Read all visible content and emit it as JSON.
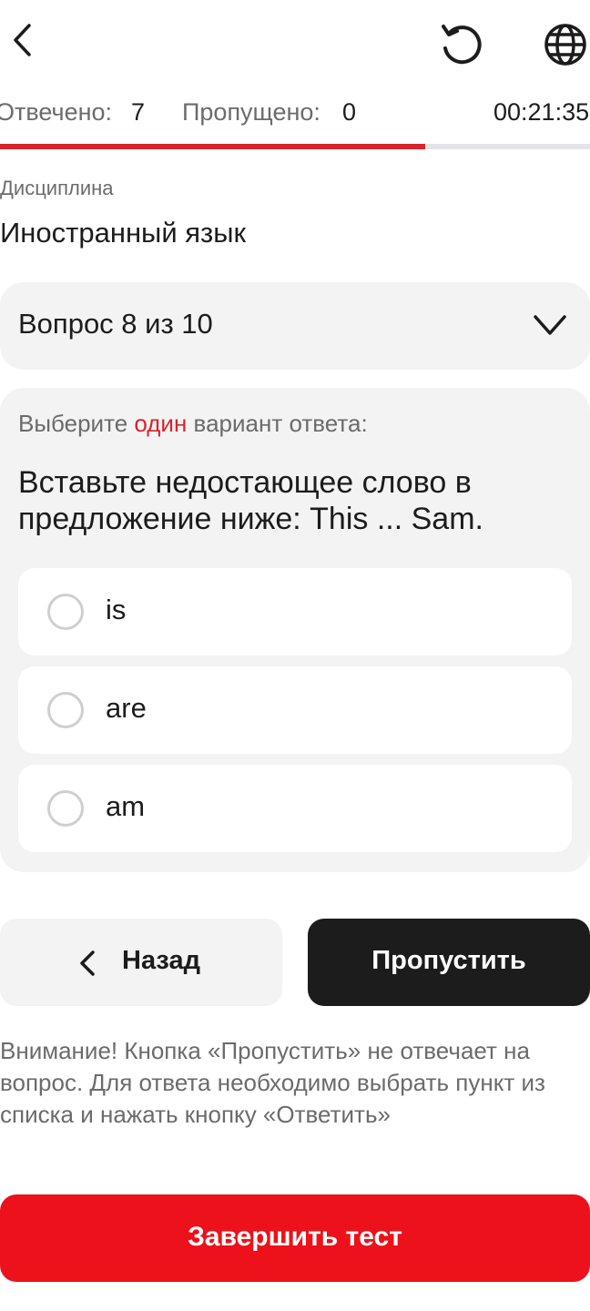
{
  "header": {
    "back_icon": "chevron-left-icon",
    "reset_icon": "reset-icon",
    "language_icon": "globe-icon"
  },
  "stats": {
    "answered_label": "Отвечено:",
    "answered_value": "7",
    "skipped_label": "Пропущено:",
    "skipped_value": "0",
    "timer": "00:21:35"
  },
  "progress": {
    "fraction": 0.72,
    "fill_color": "#d8242d",
    "track_color": "#e4e4e8"
  },
  "discipline": {
    "label": "Дисциплина",
    "value": "Иностранный язык"
  },
  "question_selector": {
    "label": "Вопрос 8 из 10",
    "icon": "chevron-down-icon"
  },
  "question": {
    "instruction_before": "Выберите ",
    "instruction_accent": "один",
    "instruction_after": " вариант ответа:",
    "text": "Вставьте недостающее слово в предложение ниже: This ... Sam.",
    "options": [
      {
        "label": "is",
        "selected": false
      },
      {
        "label": "are",
        "selected": false
      },
      {
        "label": "am",
        "selected": false
      }
    ]
  },
  "actions": {
    "back_label": "Назад",
    "back_icon": "chevron-left-icon",
    "skip_label": "Пропустить",
    "warning": "Внимание! Кнопка «Пропустить» не отвечает на вопрос. Для ответа необходимо выбрать пункт из списка и нажать кнопку «Ответить»",
    "finish_label": "Завершить тест"
  },
  "colors": {
    "accent_red": "#ec111a",
    "dark": "#1c1c1c",
    "card_bg": "#f3f3f3"
  }
}
